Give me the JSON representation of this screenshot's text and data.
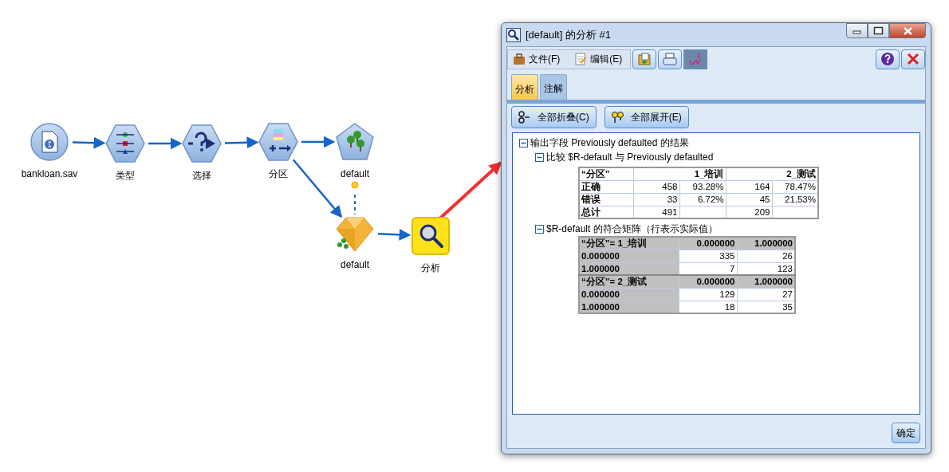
{
  "canvas": {
    "nodes": [
      {
        "label": "bankloan.sav",
        "kind": "source"
      },
      {
        "label": "类型",
        "kind": "type"
      },
      {
        "label": "选择",
        "kind": "select"
      },
      {
        "label": "分区",
        "kind": "partition"
      },
      {
        "label": "default",
        "kind": "model"
      },
      {
        "label": "default",
        "kind": "nugget"
      },
      {
        "label": "分析",
        "kind": "analysis"
      }
    ]
  },
  "window": {
    "title": "[default] 的分析 #1",
    "menu": [
      "文件(F)",
      "编辑(E)"
    ],
    "toolbar": [
      {
        "kind": "export",
        "pressed": false
      },
      {
        "kind": "print",
        "pressed": false
      },
      {
        "kind": "labels",
        "pressed": true
      }
    ],
    "tabs": [
      {
        "label": "分析",
        "selected": true
      },
      {
        "label": "注解",
        "selected": false
      }
    ],
    "actions": [
      "全部折叠(C)",
      "全部展开(E)"
    ],
    "tree": [
      {
        "label": "输出字段 Previously defaulted 的结果",
        "expanded": true,
        "children": [
          {
            "label": "比较 $R-default 与 Previously defaulted",
            "expanded": true,
            "table": {
              "header": [
                "“分区”",
                "1_培训",
                "2_测试"
              ],
              "rows": [
                {
                  "label": "正确",
                  "cells": [
                    "458",
                    "93.28%",
                    "164",
                    "78.47%"
                  ]
                },
                {
                  "label": "错误",
                  "cells": [
                    "33",
                    "6.72%",
                    "45",
                    "21.53%"
                  ]
                },
                {
                  "label": "总计",
                  "cells": [
                    "491",
                    null,
                    "209",
                    null
                  ]
                }
              ]
            }
          },
          {
            "label": "$R-default 的符合矩阵（行表示实际值）",
            "expanded": true,
            "matrices": [
              {
                "header": [
                  "“分区”= 1_培训",
                  "0.000000",
                  "1.000000"
                ],
                "rows": [
                  {
                    "label": "0.000000",
                    "cells": [
                      "335",
                      "26"
                    ]
                  },
                  {
                    "label": "1.000000",
                    "cells": [
                      "7",
                      "123"
                    ]
                  }
                ]
              },
              {
                "header": [
                  "“分区”= 2_测试",
                  "0.000000",
                  "1.000000"
                ],
                "rows": [
                  {
                    "label": "0.000000",
                    "cells": [
                      "129",
                      "27"
                    ]
                  },
                  {
                    "label": "1.000000",
                    "cells": [
                      "18",
                      "35"
                    ]
                  }
                ]
              }
            ]
          }
        ]
      }
    ],
    "ok_button": "确定"
  }
}
